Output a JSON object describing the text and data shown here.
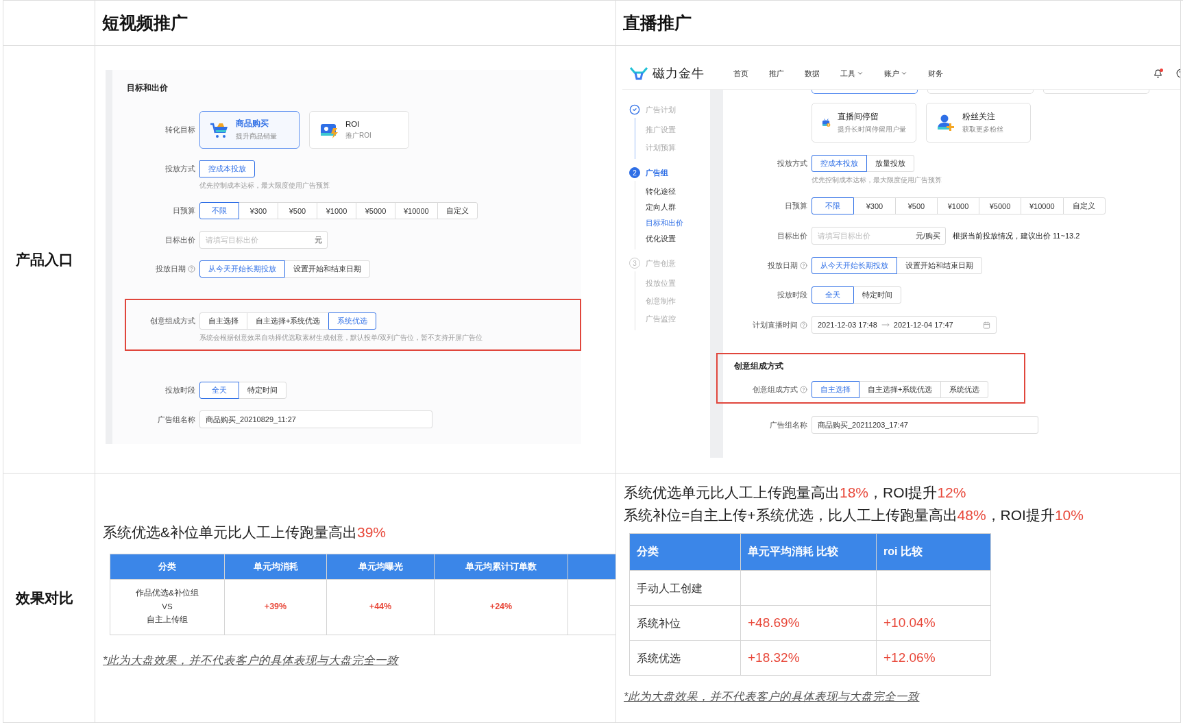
{
  "table": {
    "columns": [
      "短视频推广",
      "直播推广"
    ],
    "rows": [
      {
        "label": "产品入口"
      },
      {
        "label": "效果对比"
      }
    ]
  },
  "short_video": {
    "screenshot": {
      "fields": [
        {
          "kind": "section_title",
          "text": "目标和出价"
        },
        {
          "kind": "goal_cards",
          "label": "转化目标",
          "cards": [
            {
              "title": "商品购买",
              "subtitle": "提升商品销量",
              "selected": true
            },
            {
              "title": "ROI",
              "subtitle": "推广ROI",
              "selected": false
            }
          ]
        },
        {
          "kind": "segmented",
          "label": "投放方式",
          "help": false,
          "options": [
            {
              "label": "控成本投放",
              "selected": true
            }
          ],
          "hint": "优先控制成本达标，最大限度使用广告预算"
        },
        {
          "kind": "segmented",
          "label": "日预算",
          "help": false,
          "options": [
            {
              "label": "不限",
              "selected": true
            },
            {
              "label": "¥300",
              "selected": false
            },
            {
              "label": "¥500",
              "selected": false
            },
            {
              "label": "¥1000",
              "selected": false
            },
            {
              "label": "¥5000",
              "selected": false
            },
            {
              "label": "¥10000",
              "selected": false
            },
            {
              "label": "自定义",
              "selected": false
            }
          ]
        },
        {
          "kind": "input",
          "label": "目标出价",
          "placeholder": "请填写目标出价",
          "suffix": "元"
        },
        {
          "kind": "segmented",
          "label": "投放日期",
          "help": true,
          "options": [
            {
              "label": "从今天开始长期投放",
              "selected": true
            },
            {
              "label": "设置开始和结束日期",
              "selected": false
            }
          ]
        },
        {
          "kind": "highlight",
          "fields": [
            {
              "kind": "segmented",
              "label": "创意组成方式",
              "options": [
                {
                  "label": "自主选择",
                  "selected": false
                },
                {
                  "label": "自主选择+系统优选",
                  "selected": false
                },
                {
                  "label": "系统优选",
                  "selected": true
                }
              ],
              "hint": "系统会根据创意效果自动择优选取素材生成创意，默认投单/双列广告位，暂不支持开屏广告位"
            }
          ]
        },
        {
          "kind": "segmented",
          "label": "投放时段",
          "help": false,
          "options": [
            {
              "label": "全天",
              "selected": true
            },
            {
              "label": "特定时间",
              "selected": false
            }
          ]
        },
        {
          "kind": "input",
          "label": "广告组名称",
          "value": "商品购买_20210829_11:27"
        }
      ]
    },
    "results": {
      "headlines": [
        {
          "parts": [
            {
              "text": "系统优选&补位单元比人工上传跑量高出",
              "highlight": false
            },
            {
              "text": "39%",
              "highlight": true
            }
          ]
        }
      ],
      "table": {
        "columns": [
          "分类",
          "单元均消耗",
          "单元均曝光",
          "单元均累计订单数"
        ],
        "more_columns_cut": true,
        "rows": [
          {
            "category": "作品优选&补位组\nVS\n自主上传组",
            "values": [
              "+39%",
              "+44%",
              "+24%"
            ]
          }
        ]
      },
      "footnote": "*此为大盘效果，并不代表客户的具体表现与大盘完全一致"
    }
  },
  "live": {
    "screenshot": {
      "logo": "磁力金牛",
      "nav": [
        {
          "label": "首页",
          "dropdown": false
        },
        {
          "label": "推广",
          "dropdown": false
        },
        {
          "label": "数据",
          "dropdown": false
        },
        {
          "label": "工具",
          "dropdown": true
        },
        {
          "label": "账户",
          "dropdown": true
        },
        {
          "label": "财务",
          "dropdown": false
        }
      ],
      "notifications": {
        "unread": true
      },
      "steps": [
        {
          "completed": true,
          "current": false,
          "title": "广告计划",
          "children": [
            {
              "label": "推广设置",
              "selected": false
            },
            {
              "label": "计划预算",
              "selected": false
            }
          ]
        },
        {
          "completed": false,
          "current": true,
          "number": "2",
          "title": "广告组",
          "children": [
            {
              "label": "转化途径",
              "selected": false
            },
            {
              "label": "定向人群",
              "selected": false
            },
            {
              "label": "目标和出价",
              "selected": true
            },
            {
              "label": "优化设置",
              "selected": false
            }
          ]
        },
        {
          "completed": false,
          "current": false,
          "number": "3",
          "title": "广告创意",
          "children": [
            {
              "label": "投放位置",
              "selected": false
            },
            {
              "label": "创意制作",
              "selected": false
            },
            {
              "label": "广告监控",
              "selected": false
            }
          ]
        }
      ],
      "cut_cards": [
        {
          "selected": true
        },
        {
          "selected": false
        },
        {
          "selected": false
        }
      ],
      "fields": [
        {
          "kind": "goal_cards",
          "cards": [
            {
              "title": "直播间停留",
              "subtitle": "提升长时间停留用户量",
              "selected": false
            },
            {
              "title": "粉丝关注",
              "subtitle": "获取更多粉丝",
              "selected": false
            }
          ]
        },
        {
          "kind": "segmented",
          "label": "投放方式",
          "help": false,
          "options": [
            {
              "label": "控成本投放",
              "selected": true
            },
            {
              "label": "放量投放",
              "selected": false
            }
          ],
          "hint": "优先控制成本达标，最大限度使用广告预算"
        },
        {
          "kind": "segmented",
          "label": "日预算",
          "help": false,
          "options": [
            {
              "label": "不限",
              "selected": true
            },
            {
              "label": "¥300",
              "selected": false
            },
            {
              "label": "¥500",
              "selected": false
            },
            {
              "label": "¥1000",
              "selected": false
            },
            {
              "label": "¥5000",
              "selected": false
            },
            {
              "label": "¥10000",
              "selected": false
            },
            {
              "label": "自定义",
              "selected": false
            }
          ]
        },
        {
          "kind": "input",
          "label": "目标出价",
          "placeholder": "请填写目标出价",
          "suffix": "元/购买",
          "note": "根据当前投放情况，建议出价 11~13.2"
        },
        {
          "kind": "segmented",
          "label": "投放日期",
          "help": true,
          "options": [
            {
              "label": "从今天开始长期投放",
              "selected": true
            },
            {
              "label": "设置开始和结束日期",
              "selected": false
            }
          ]
        },
        {
          "kind": "segmented",
          "label": "投放时段",
          "help": false,
          "options": [
            {
              "label": "全天",
              "selected": true
            },
            {
              "label": "特定时间",
              "selected": false
            }
          ]
        },
        {
          "kind": "date_range",
          "label": "计划直播时间",
          "help": true,
          "start": "2021-12-03 17:48",
          "end": "2021-12-04 17:47"
        },
        {
          "kind": "highlight",
          "title": "创意组成方式",
          "fields": [
            {
              "kind": "segmented",
              "label": "创意组成方式",
              "help": true,
              "options": [
                {
                  "label": "自主选择",
                  "selected": true
                },
                {
                  "label": "自主选择+系统优选",
                  "selected": false
                },
                {
                  "label": "系统优选",
                  "selected": false
                }
              ]
            }
          ]
        },
        {
          "kind": "input",
          "label": "广告组名称",
          "value": "商品购买_20211203_17:47"
        }
      ]
    },
    "results": {
      "headlines": [
        {
          "parts": [
            {
              "text": "系统优选单元比人工上传跑量高出",
              "highlight": false
            },
            {
              "text": "18%",
              "highlight": true
            },
            {
              "text": "，ROI提升",
              "highlight": false
            },
            {
              "text": "12%",
              "highlight": true
            }
          ]
        },
        {
          "parts": [
            {
              "text": "系统补位=自主上传+系统优选，比人工上传跑量高出",
              "highlight": false
            },
            {
              "text": "48%",
              "highlight": true
            },
            {
              "text": "，ROI提升",
              "highlight": false
            },
            {
              "text": "10%",
              "highlight": true
            }
          ]
        }
      ],
      "table": {
        "columns": [
          "分类",
          "单元平均消耗 比较",
          "roi 比较"
        ],
        "rows": [
          {
            "category": "手动人工创建"
          },
          {
            "category": "系统补位",
            "values": [
              "+48.69%",
              "+10.04%"
            ]
          },
          {
            "category": "系统优选",
            "values": [
              "+18.32%",
              "+12.06%"
            ]
          }
        ]
      },
      "footnote": "*此为大盘效果，并不代表客户的具体表现与大盘完全一致"
    }
  }
}
